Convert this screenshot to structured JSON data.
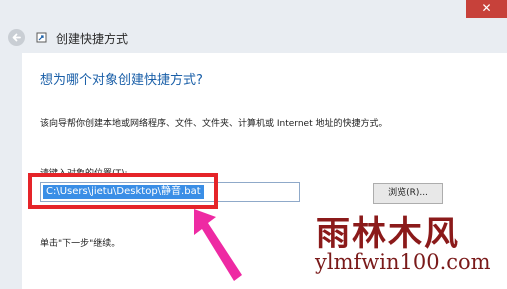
{
  "window": {
    "close_glyph": "✕",
    "title": "创建快捷方式"
  },
  "dialog": {
    "heading": "想为哪个对象创建快捷方式?",
    "description": "该向导帮你创建本地或网络程序、文件、文件夹、计算机或 Internet 地址的快捷方式。",
    "location_label": "请键入对象的位置(T):",
    "location_value": "C:\\Users\\jietu\\Desktop\\静音.bat",
    "browse_label": "浏览(R)...",
    "hint": "单击\"下一步\"继续。"
  },
  "annotation": {
    "highlight_color": "#e52429",
    "arrow_color": "#ee2aa3"
  },
  "watermark": {
    "brand": "雨林木风",
    "url": "ylmfwin100.com"
  },
  "colors": {
    "heading": "#1a5fa8",
    "selection": "#3a8ee6",
    "close": "#c7413a"
  }
}
